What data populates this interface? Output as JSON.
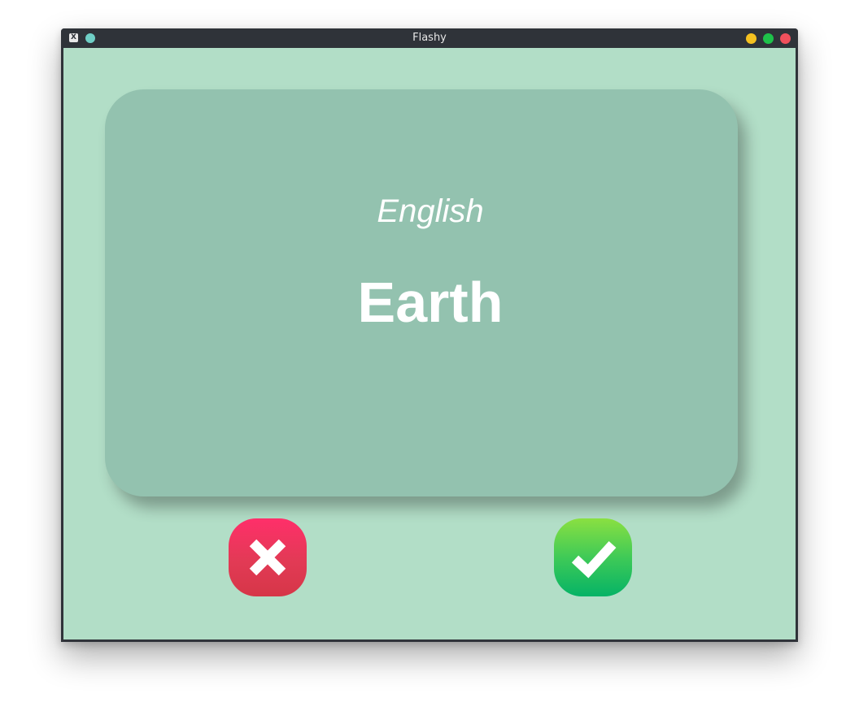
{
  "window": {
    "title": "Flashy",
    "app_icon": "x-window-icon",
    "pin_icon": "pin-dot-icon",
    "controls": {
      "minimize_color": "#f5c120",
      "maximize_color": "#1ec24a",
      "close_color": "#f0505c"
    }
  },
  "card": {
    "language": "English",
    "word": "Earth",
    "background": "#93c2af"
  },
  "actions": {
    "wrong_icon": "close-x-icon",
    "correct_icon": "checkmark-icon",
    "wrong_color": "#e23a55",
    "correct_color": "#2bc25c"
  },
  "theme": {
    "background": "#b2dec7",
    "titlebar": "#2f3339"
  }
}
